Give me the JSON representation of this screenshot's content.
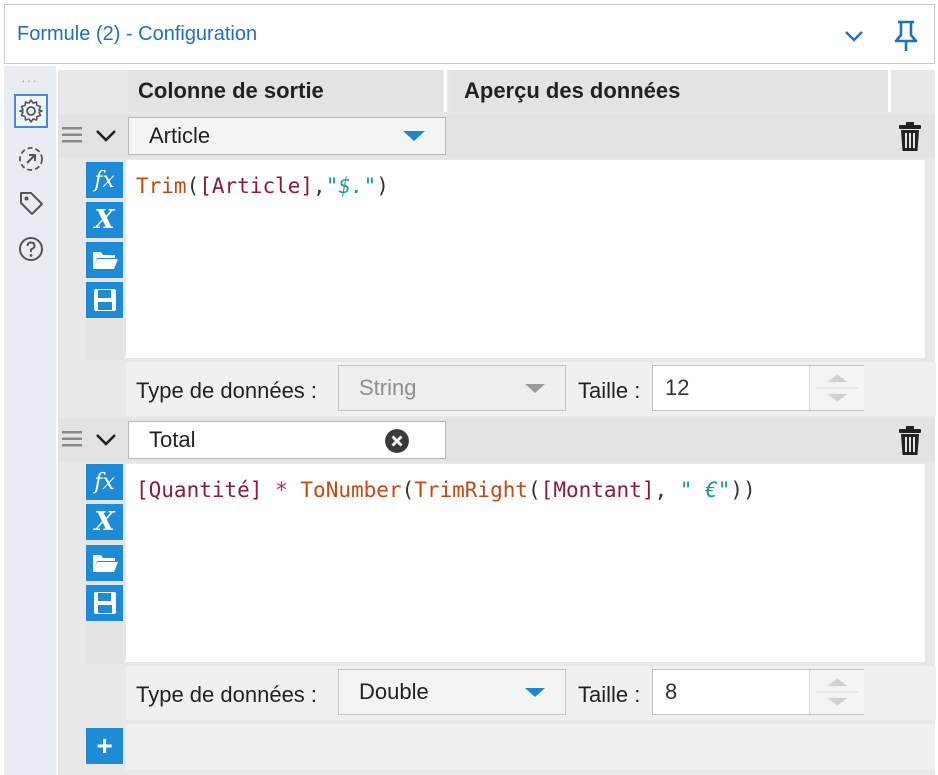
{
  "window": {
    "title": "Formule (2) - Configuration"
  },
  "columns": {
    "output": "Colonne de sortie",
    "preview": "Aperçu des données"
  },
  "expressions": [
    {
      "field": "Article",
      "field_kind": "dropdown",
      "tokens": [
        {
          "t": "fn",
          "v": "Trim"
        },
        {
          "t": "pun",
          "v": "("
        },
        {
          "t": "fld",
          "v": "[Article]"
        },
        {
          "t": "pun",
          "v": ","
        },
        {
          "t": "str",
          "v": "\"$.\""
        },
        {
          "t": "pun",
          "v": ")"
        }
      ],
      "type_label": "Type de données :",
      "type_value": "String",
      "type_enabled": false,
      "size_label": "Taille :",
      "size_value": "12"
    },
    {
      "field": "Total",
      "field_kind": "text",
      "tokens": [
        {
          "t": "fld",
          "v": "[Quantité]"
        },
        {
          "t": "pun",
          "v": " "
        },
        {
          "t": "op",
          "v": "*"
        },
        {
          "t": "pun",
          "v": " "
        },
        {
          "t": "fn",
          "v": "ToNumber"
        },
        {
          "t": "pun",
          "v": "("
        },
        {
          "t": "fn",
          "v": "TrimRight"
        },
        {
          "t": "pun",
          "v": "("
        },
        {
          "t": "fld",
          "v": "[Montant]"
        },
        {
          "t": "pun",
          "v": ", "
        },
        {
          "t": "str",
          "v": "\" €\""
        },
        {
          "t": "pun",
          "v": "))"
        }
      ],
      "type_label": "Type de données :",
      "type_value": "Double",
      "type_enabled": true,
      "size_label": "Taille :",
      "size_value": "8"
    }
  ],
  "colors": {
    "accent": "#1d8bd6",
    "title": "#1f6fbf",
    "function": "#c04a12",
    "field": "#8a1b3c",
    "string": "#1a9a9a",
    "operator": "#c21a8d"
  },
  "icons": {
    "rail": [
      "gear-icon",
      "output-icon",
      "tag-icon",
      "help-icon"
    ],
    "editor_buttons": [
      "fx-icon",
      "variable-icon",
      "open-folder-icon",
      "save-icon"
    ]
  }
}
